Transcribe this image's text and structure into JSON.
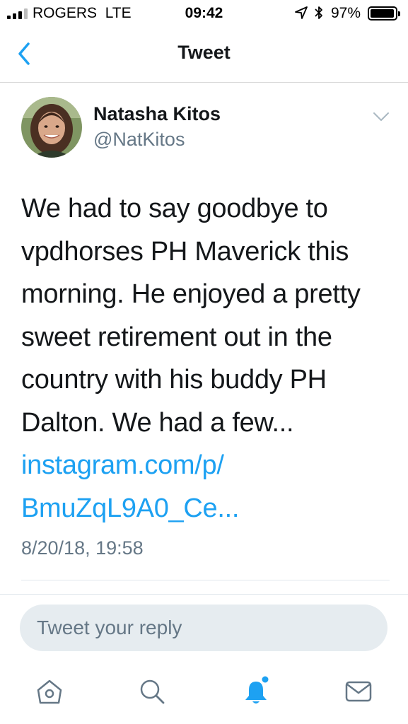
{
  "status_bar": {
    "carrier": "ROGERS",
    "network": "LTE",
    "time": "09:42",
    "battery_percent": "97%",
    "icons": [
      "signal-icon",
      "location-arrow-icon",
      "bluetooth-icon",
      "battery-icon"
    ]
  },
  "nav": {
    "title": "Tweet",
    "back_icon": "back-chevron-icon"
  },
  "tweet": {
    "author_name": "Natasha Kitos",
    "author_handle": "@NatKitos",
    "text": "We had to say goodbye to\nvpdhorses PH Maverick this\nmorning. He enjoyed a pretty\nsweet retirement out in the\ncountry with his buddy PH\nDalton. We had a few...",
    "link": "instagram.com/p/\nBmuZqL9A0_Ce...",
    "timestamp": "8/20/18, 19:58"
  },
  "reply": {
    "placeholder": "Tweet your reply"
  },
  "tab_bar": {
    "tabs": [
      "home-icon",
      "search-icon",
      "notifications-icon",
      "messages-icon"
    ],
    "active": "notifications-icon",
    "has_unread_notifications": true
  },
  "colors": {
    "accent": "#1da1f2",
    "secondary_text": "#657786",
    "primary_text": "#14171a",
    "reply_background": "#e6ecf0",
    "inactive_icon": "#657786"
  }
}
